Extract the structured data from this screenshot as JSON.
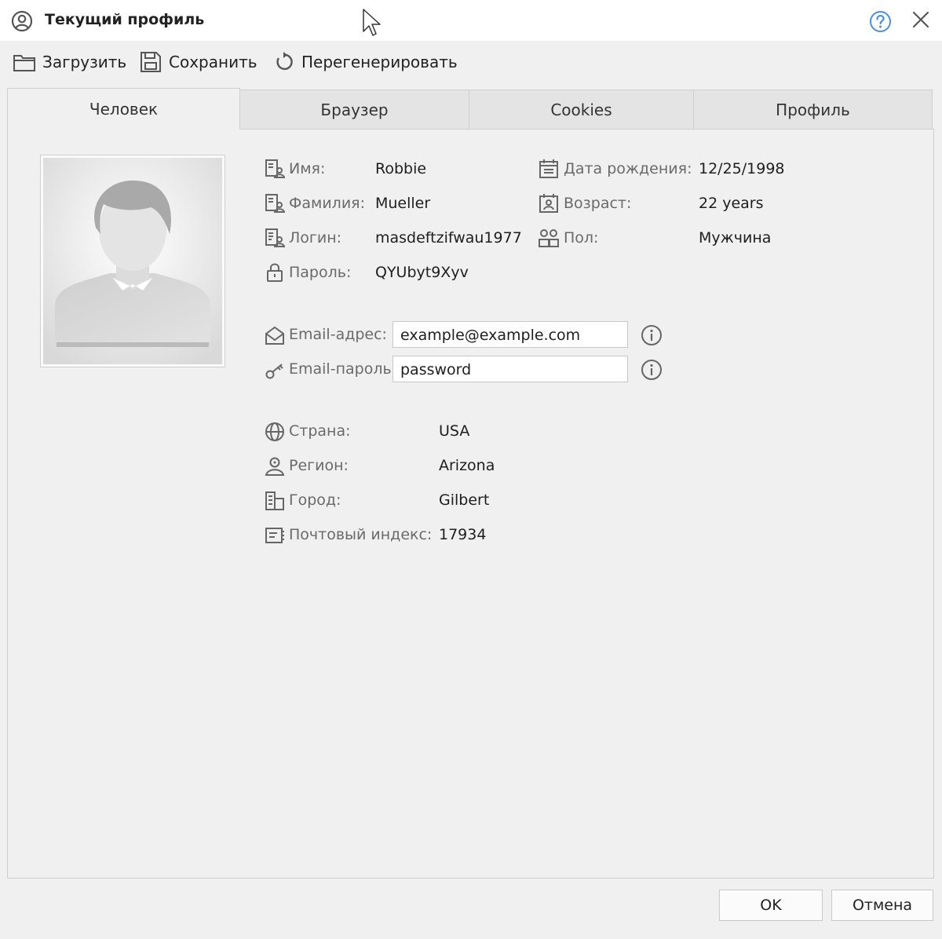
{
  "window": {
    "title": "Текущий профиль",
    "icons": {
      "title": "user-circle-icon",
      "help": "question-circle-icon",
      "close": "close-icon"
    },
    "accent_color": "#4a8fe0"
  },
  "toolbar": {
    "load_label": "Загрузить",
    "save_label": "Сохранить",
    "regenerate_label": "Перегенерировать"
  },
  "tabs": [
    {
      "label": "Человек",
      "active": true
    },
    {
      "label": "Браузер",
      "active": false
    },
    {
      "label": "Cookies",
      "active": false
    },
    {
      "label": "Профиль",
      "active": false
    }
  ],
  "person": {
    "first_name": {
      "label": "Имя:",
      "value": "Robbie"
    },
    "last_name": {
      "label": "Фамилия:",
      "value": "Mueller"
    },
    "login": {
      "label": "Логин:",
      "value": "masdeftzifwau1977"
    },
    "password": {
      "label": "Пароль:",
      "value": "QYUbyt9Xyv"
    },
    "birth_date": {
      "label": "Дата рождения:",
      "value": "12/25/1998"
    },
    "age": {
      "label": "Возраст:",
      "value": "22 years"
    },
    "gender": {
      "label": "Пол:",
      "value": "Мужчина"
    }
  },
  "email": {
    "address": {
      "label": "Email-адрес:",
      "value": "example@example.com"
    },
    "password": {
      "label": "Email-пароль:",
      "value": "password"
    }
  },
  "location": {
    "country": {
      "label": "Страна:",
      "value": "USA"
    },
    "region": {
      "label": "Регион:",
      "value": "Arizona"
    },
    "city": {
      "label": "Город:",
      "value": "Gilbert"
    },
    "zip": {
      "label": "Почтовый индекс:",
      "value": "17934"
    }
  },
  "footer": {
    "ok_label": "OK",
    "cancel_label": "Отмена"
  }
}
